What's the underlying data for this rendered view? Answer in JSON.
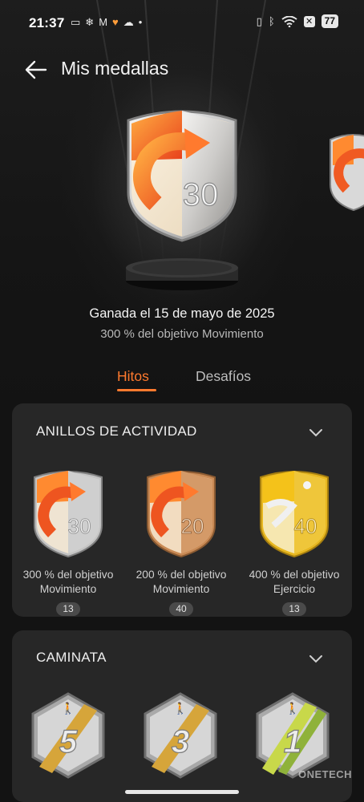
{
  "status_bar": {
    "time": "21:37",
    "battery": "77",
    "left_icons": [
      "video-icon",
      "snowflake-icon",
      "gmail-icon",
      "heart-icon",
      "cloud-icon",
      "dot-icon"
    ],
    "right_icons": [
      "vibrate-icon",
      "bluetooth-icon",
      "wifi-icon",
      "x-icon",
      "battery-icon"
    ]
  },
  "header": {
    "title": "Mis medallas"
  },
  "hero": {
    "medal_number": "30",
    "earned_text": "Ganada el 15 de mayo de 2025",
    "goal_text": "300 % del objetivo Movimiento"
  },
  "tabs": [
    {
      "label": "Hitos",
      "active": true
    },
    {
      "label": "Desafíos",
      "active": false
    }
  ],
  "sections": {
    "activity_rings": {
      "title": "ANILLOS DE ACTIVIDAD",
      "medals": [
        {
          "number": "30",
          "line1": "300 % del objetivo",
          "line2": "Movimiento",
          "count": "13",
          "style": "silver"
        },
        {
          "number": "20",
          "line1": "200 % del objetivo",
          "line2": "Movimiento",
          "count": "40",
          "style": "bronze"
        },
        {
          "number": "40",
          "line1": "400 % del objetivo",
          "line2": "Ejercicio",
          "count": "13",
          "style": "gold"
        }
      ]
    },
    "walking": {
      "title": "CAMINATA",
      "medals": [
        {
          "number": "5",
          "stripe": "#d6a53a"
        },
        {
          "number": "3",
          "stripe": "#d6a53a"
        },
        {
          "number": "1",
          "stripe": "#c8d84a"
        }
      ]
    }
  },
  "watermark": "ONETECH",
  "colors": {
    "accent": "#ff7a2e",
    "background": "#131313",
    "card": "#272727"
  }
}
